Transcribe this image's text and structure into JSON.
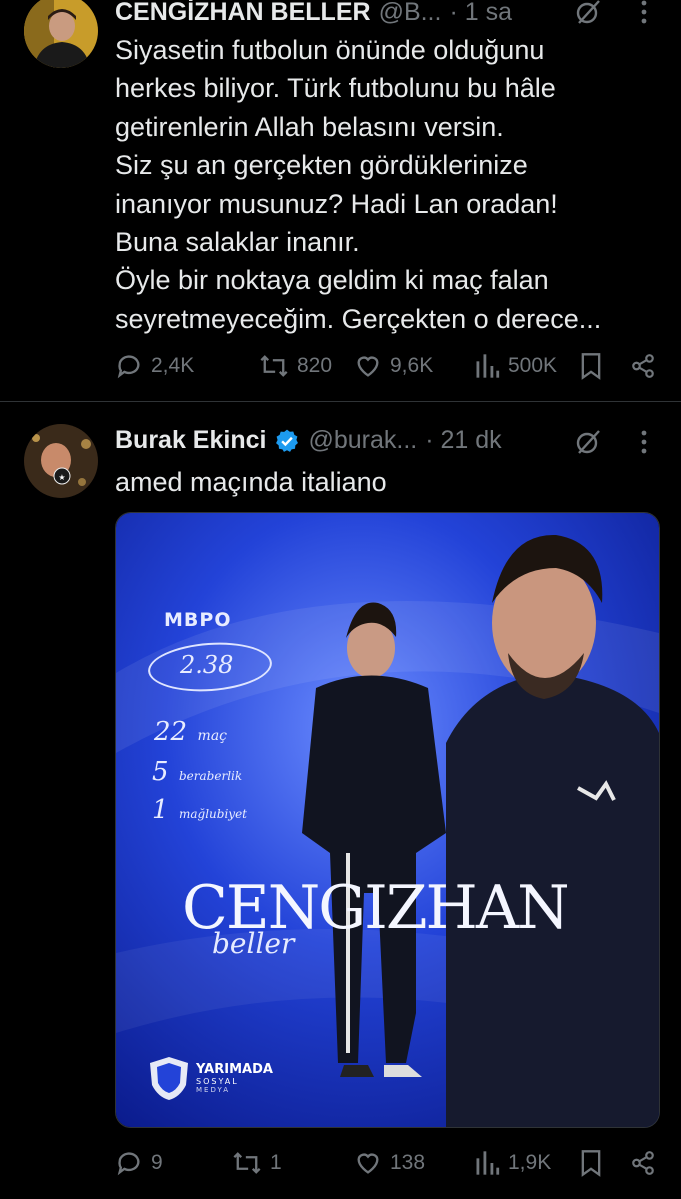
{
  "tweet1": {
    "name": "CENGİZHAN BELLER",
    "handle": "@B...",
    "time": "· 1 sa",
    "lines": [
      "Siyasetin futbolun önünde olduğunu",
      "herkes biliyor. Türk futbolunu bu hâle",
      "getirenlerin Allah belasını versin.",
      "Siz şu an gerçekten gördüklerinize",
      "inanıyor musunuz? Hadi Lan oradan!",
      "Buna salaklar inanır.",
      "Öyle bir noktaya geldim ki maç falan",
      "seyretmeyeceğim. Gerçekten o derece..."
    ],
    "stats": {
      "replies": "2,4K",
      "reposts": "820",
      "likes": "9,6K",
      "views": "500K"
    }
  },
  "tweet2": {
    "name": "Burak Ekinci",
    "handle": "@burak...",
    "time": "· 21 dk",
    "text": "amed maçında italiano",
    "stats": {
      "replies": "9",
      "reposts": "1",
      "likes": "138",
      "views": "1,9K"
    },
    "poster": {
      "mbpo_label": "MBPO",
      "mbpo_value": "2.38",
      "matches": "22",
      "matches_label": "maç",
      "draws": "5",
      "draws_label": "beraberlik",
      "losses": "1",
      "losses_label": "mağlubiyet",
      "title_first": "CENGIZHAN",
      "title_last": "beller",
      "logo_title": "YARIMADA",
      "logo_sub": "SOSYAL",
      "logo_sub2": "MEDYA"
    }
  },
  "colors": {
    "background": "#000000",
    "text": "#e7e9ea",
    "muted": "#71767b",
    "verified": "#1d9bf0",
    "poster_blue": "#1f3fd6"
  }
}
